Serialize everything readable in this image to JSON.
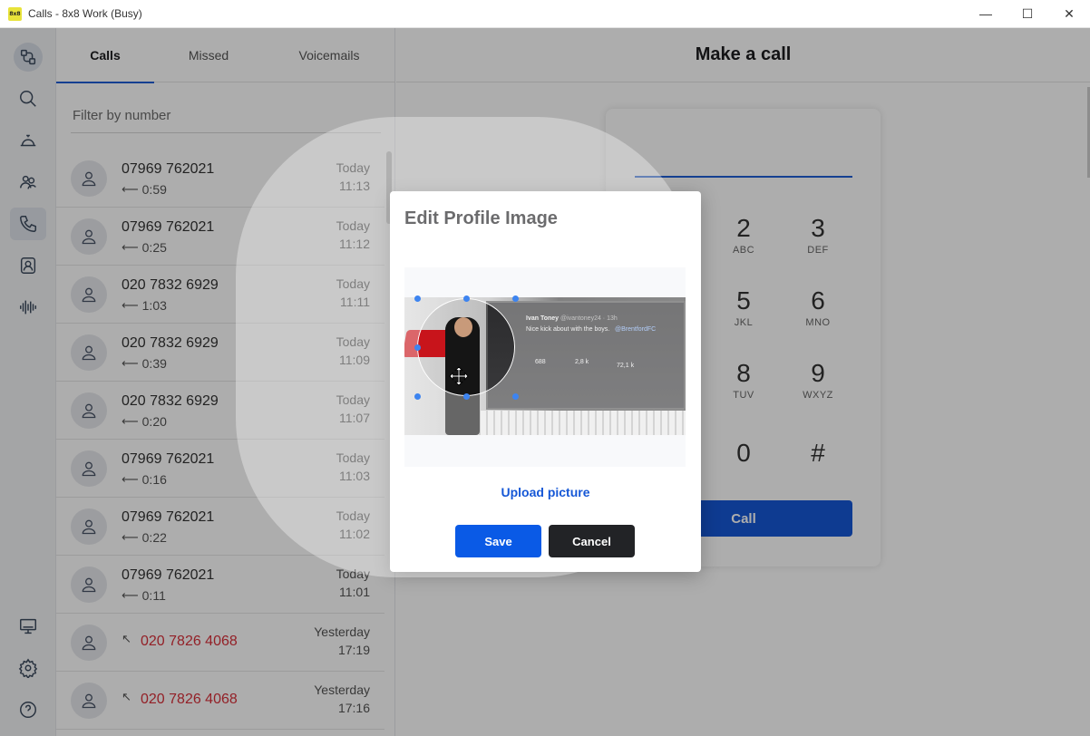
{
  "window": {
    "title": "Calls - 8x8 Work (Busy)",
    "logo_text": "8x8",
    "minimize": "—",
    "maximize": "☐",
    "close": "✕"
  },
  "rail": {
    "items": [
      "workspace-icon",
      "search-icon",
      "bell-icon",
      "contacts-icon",
      "phone-icon",
      "directory-icon",
      "voicemail-icon"
    ],
    "bottom_items": [
      "monitor-icon",
      "gear-icon",
      "help-icon"
    ]
  },
  "tabs": [
    {
      "label": "Calls",
      "active": true
    },
    {
      "label": "Missed",
      "active": false
    },
    {
      "label": "Voicemails",
      "active": false
    }
  ],
  "filter": {
    "placeholder": "Filter by number"
  },
  "calls": [
    {
      "number": "07969 762021",
      "duration": "0:59",
      "day": "Today",
      "time": "11:13",
      "missed": false
    },
    {
      "number": "07969 762021",
      "duration": "0:25",
      "day": "Today",
      "time": "11:12",
      "missed": false
    },
    {
      "number": "020 7832 6929",
      "duration": "1:03",
      "day": "Today",
      "time": "11:11",
      "missed": false
    },
    {
      "number": "020 7832 6929",
      "duration": "0:39",
      "day": "Today",
      "time": "11:09",
      "missed": false
    },
    {
      "number": "020 7832 6929",
      "duration": "0:20",
      "day": "Today",
      "time": "11:07",
      "missed": false
    },
    {
      "number": "07969 762021",
      "duration": "0:16",
      "day": "Today",
      "time": "11:03",
      "missed": false
    },
    {
      "number": "07969 762021",
      "duration": "0:22",
      "day": "Today",
      "time": "11:02",
      "missed": false
    },
    {
      "number": "07969 762021",
      "duration": "0:11",
      "day": "Today",
      "time": "11:01",
      "missed": false
    },
    {
      "number": "020 7826 4068",
      "duration": "",
      "day": "Yesterday",
      "time": "17:19",
      "missed": true
    },
    {
      "number": "020 7826 4068",
      "duration": "",
      "day": "Yesterday",
      "time": "17:16",
      "missed": true
    }
  ],
  "dialer": {
    "title": "Make a call",
    "keys": [
      {
        "digit": "2",
        "letters": "ABC"
      },
      {
        "digit": "3",
        "letters": "DEF"
      },
      {
        "digit": "5",
        "letters": "JKL"
      },
      {
        "digit": "6",
        "letters": "MNO"
      },
      {
        "digit": "8",
        "letters": "TUV"
      },
      {
        "digit": "9",
        "letters": "WXYZ"
      },
      {
        "digit": "0",
        "letters": ""
      },
      {
        "digit": "#",
        "letters": ""
      }
    ],
    "call_label": "Call"
  },
  "modal": {
    "title": "Edit Profile Image",
    "upload_label": "Upload picture",
    "save_label": "Save",
    "cancel_label": "Cancel",
    "photo_tweet": {
      "name": "Ivan Toney",
      "handle": "@ivantoney24 · 13h",
      "text": "Nice kick about with the boys.",
      "mention": "@BrentfordFC",
      "retweets": "2,8 k",
      "likes": "72,1 k",
      "replies": "688"
    }
  },
  "colors": {
    "accent": "#1557d6",
    "missed": "#d9303a",
    "cancel_bg": "#222326"
  }
}
